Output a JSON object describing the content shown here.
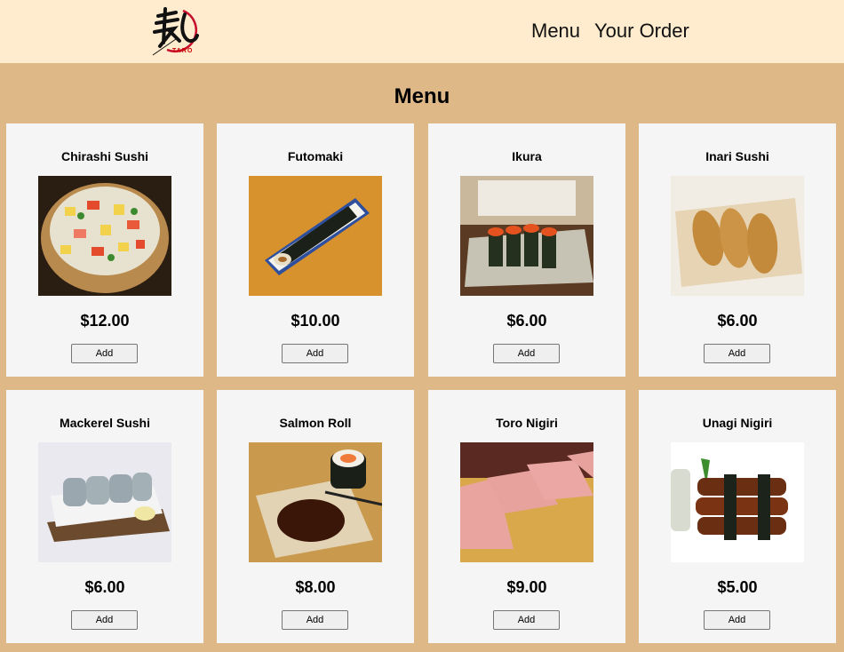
{
  "header": {
    "logo_text": "TARO",
    "nav": [
      "Menu",
      "Your Order"
    ]
  },
  "page_title": "Menu",
  "items": [
    {
      "name": "Chirashi Sushi",
      "price": "$12.00",
      "button": "Add"
    },
    {
      "name": "Futomaki",
      "price": "$10.00",
      "button": "Add"
    },
    {
      "name": "Ikura",
      "price": "$6.00",
      "button": "Add"
    },
    {
      "name": "Inari Sushi",
      "price": "$6.00",
      "button": "Add"
    },
    {
      "name": "Mackerel Sushi",
      "price": "$6.00",
      "button": "Add"
    },
    {
      "name": "Salmon Roll",
      "price": "$8.00",
      "button": "Add"
    },
    {
      "name": "Toro Nigiri",
      "price": "$9.00",
      "button": "Add"
    },
    {
      "name": "Unagi Nigiri",
      "price": "$5.00",
      "button": "Add"
    }
  ],
  "colors": {
    "header_bg": "#ffebcd",
    "page_bg": "#deb887",
    "card_bg": "#f5f5f5"
  }
}
